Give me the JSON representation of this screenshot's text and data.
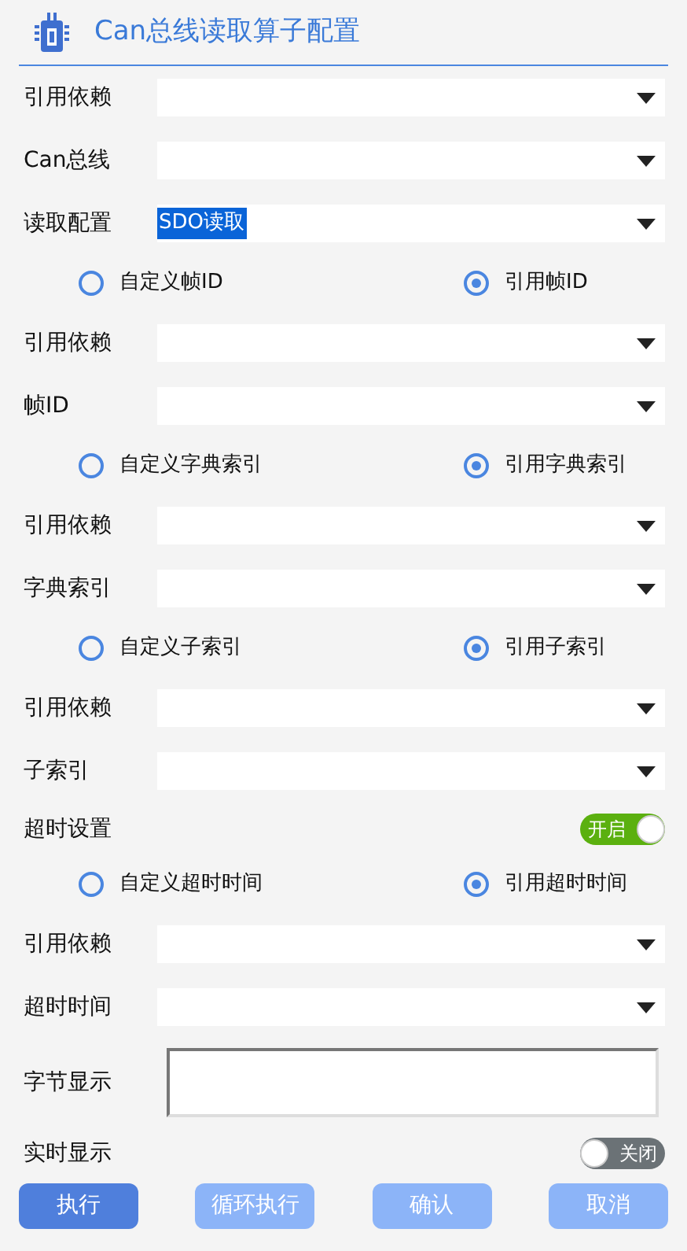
{
  "title": "Can总线读取算子配置",
  "rows": [
    {
      "kind": "select",
      "label": "引用依赖",
      "value": ""
    },
    {
      "kind": "select",
      "label": "Can总线",
      "value": ""
    },
    {
      "kind": "select",
      "label": "读取配置",
      "value": "SDO读取",
      "highlighted": true
    },
    {
      "kind": "radio",
      "options": [
        {
          "label": "自定义帧ID",
          "selected": false
        },
        {
          "label": "引用帧ID",
          "selected": true
        }
      ]
    },
    {
      "kind": "select",
      "label": "引用依赖",
      "value": ""
    },
    {
      "kind": "select",
      "label": "帧ID",
      "value": ""
    },
    {
      "kind": "radio",
      "options": [
        {
          "label": "自定义字典索引",
          "selected": false
        },
        {
          "label": "引用字典索引",
          "selected": true
        }
      ]
    },
    {
      "kind": "select",
      "label": "引用依赖",
      "value": ""
    },
    {
      "kind": "select",
      "label": "字典索引",
      "value": ""
    },
    {
      "kind": "radio",
      "options": [
        {
          "label": "自定义子索引",
          "selected": false
        },
        {
          "label": "引用子索引",
          "selected": true
        }
      ]
    },
    {
      "kind": "select",
      "label": "引用依赖",
      "value": ""
    },
    {
      "kind": "select",
      "label": "子索引",
      "value": ""
    },
    {
      "kind": "toggle",
      "label": "超时设置",
      "on": true,
      "state_text": "开启"
    },
    {
      "kind": "radio",
      "options": [
        {
          "label": "自定义超时时间",
          "selected": false
        },
        {
          "label": "引用超时时间",
          "selected": true
        }
      ]
    },
    {
      "kind": "select",
      "label": "引用依赖",
      "value": ""
    },
    {
      "kind": "select",
      "label": "超时时间",
      "value": ""
    },
    {
      "kind": "textarea",
      "label": "字节显示",
      "value": ""
    },
    {
      "kind": "toggle",
      "label": "实时显示",
      "on": false,
      "state_text": "关闭"
    }
  ],
  "buttons": [
    {
      "label": "执行",
      "primary": true
    },
    {
      "label": "循环执行",
      "primary": false
    },
    {
      "label": "确认",
      "primary": false
    },
    {
      "label": "取消",
      "primary": false
    }
  ]
}
